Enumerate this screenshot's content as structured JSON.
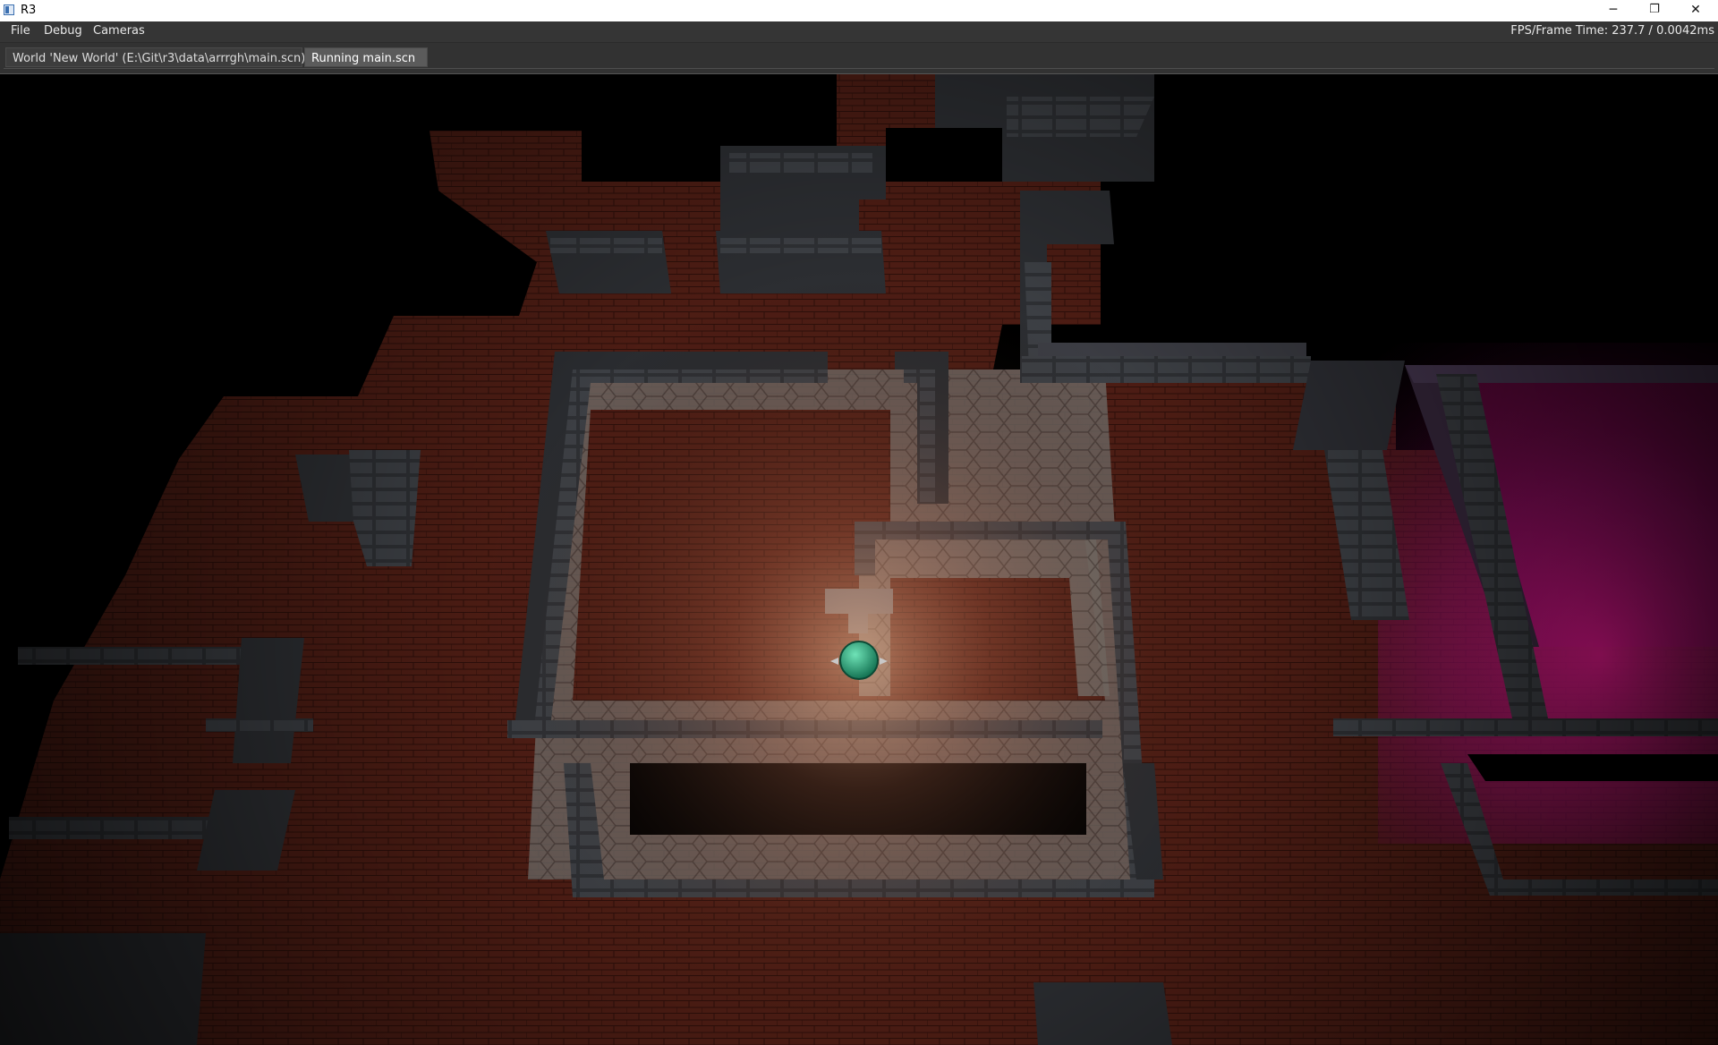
{
  "window": {
    "title": "R3",
    "controls": {
      "minimize": "─",
      "maximize": "❐",
      "close": "✕"
    }
  },
  "menubar": {
    "items": [
      "File",
      "Debug",
      "Cameras"
    ],
    "fps_text": "FPS/Frame Time: 237.7 / 0.0042ms"
  },
  "tabs": [
    {
      "label": "World 'New World' (E:\\Git\\r3\\data\\arrrgh\\main.scn)",
      "active": false
    },
    {
      "label": "Running main.scn",
      "active": true
    }
  ],
  "viewport": {
    "scene": "3d-dungeon-render",
    "colors": {
      "floor": "#5a2218",
      "floor_lit": "#b0603f",
      "wall": "#3a3c40",
      "wall_top": "#5b5d62",
      "player": "#1fa57a",
      "magenta_light": "#e0198c"
    }
  }
}
